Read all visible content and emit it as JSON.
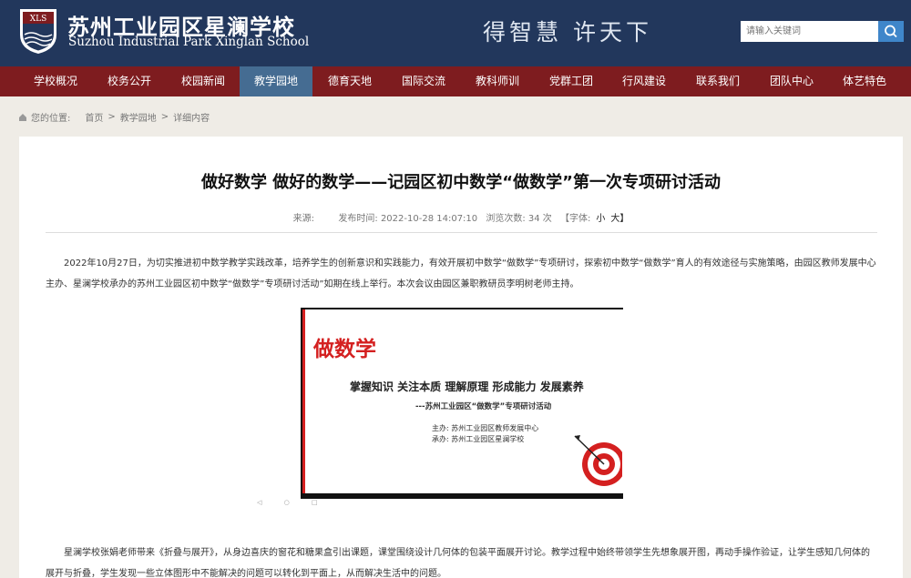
{
  "header": {
    "logo_text": "XLS",
    "title": "苏州工业园区星澜学校",
    "subtitle": "Suzhou Industrial Park Xinglan School",
    "slogan": "得智慧  许天下",
    "search_placeholder": "请输入关键词"
  },
  "nav": {
    "items": [
      "学校概况",
      "校务公开",
      "校园新闻",
      "教学园地",
      "德育天地",
      "国际交流",
      "教科师训",
      "党群工团",
      "行风建设",
      "联系我们",
      "团队中心",
      "体艺特色"
    ],
    "active": "教学园地"
  },
  "breadcrumb": {
    "label": "您的位置:",
    "items": [
      "首页",
      "教学园地",
      "详细内容"
    ]
  },
  "article": {
    "title": "做好数学 做好的数学——记园区初中数学“做数学”第一次专项研讨活动",
    "meta": {
      "source": "来源:",
      "time": "发布时间: 2022-10-28 14:07:10",
      "views": "浏览次数: 34 次",
      "font_label": "【字体:",
      "font_small": "小",
      "font_large": "大】"
    },
    "paragraph1": "2022年10月27日，为切实推进初中数学教学实践改革，培养学生的创新意识和实践能力，有效开展初中数学“做数学”专项研讨，探索初中数学“做数学”育人的有效途径与实施策略，由园区教师发展中心主办、星澜学校承办的苏州工业园区初中数学“做数学”专项研讨活动”如期在线上举行。本次会议由园区兼职教研员李明树老师主持。",
    "paragraph2": "星澜学校张娟老师带来《折叠与展开》，从身边喜庆的窗花和糖果盒引出课题，课堂围绕设计几何体的包装平面展开讨论。教学过程中始终带领学生先想象展开图，再动手操作验证，让学生感知几何体的展开与折叠，学生发现一些立体图形中不能解决的问题可以转化到平面上，从而解决生活中的问题。",
    "slide": {
      "title": "做数学",
      "motto": "掌握知识 关注本质 理解原理 形成能力 发展素养",
      "subtitle": "---苏州工业园区“做数学”专项研讨活动",
      "host": "主办:  苏州工业园区教师发展中心",
      "organizer": "承办:  苏州工业园区星澜学校",
      "controls": "◁ ○ □"
    }
  },
  "colors": {
    "header_bg": "#22375c",
    "nav_bg": "#7e1c1f",
    "nav_active": "#456c92",
    "search_button": "#3f86ca",
    "accent_red": "#d42020"
  }
}
